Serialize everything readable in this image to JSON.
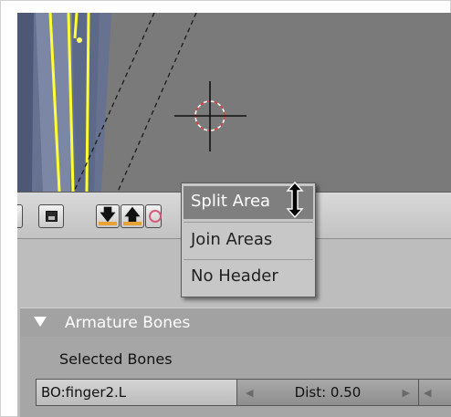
{
  "context_menu": {
    "items": [
      {
        "label": "Split Area"
      },
      {
        "label": "Join Areas"
      },
      {
        "label": "No Header"
      }
    ],
    "hovered": "Split Area"
  },
  "header_toolbar": {
    "buttons": [
      "image-icon",
      "arrow-down-icon",
      "arrow-up-icon",
      "lamp-icon"
    ],
    "accent": "#e8a23a"
  },
  "panel": {
    "title": "Armature Bones",
    "selected_label": "Selected Bones",
    "bone_name": "BO:finger2.L",
    "dist_label": "Dist: 0.50"
  },
  "viewport": {
    "background": "#7a7a7a",
    "bone_color": "#ffff33",
    "cursor": "3d-cursor-icon"
  }
}
